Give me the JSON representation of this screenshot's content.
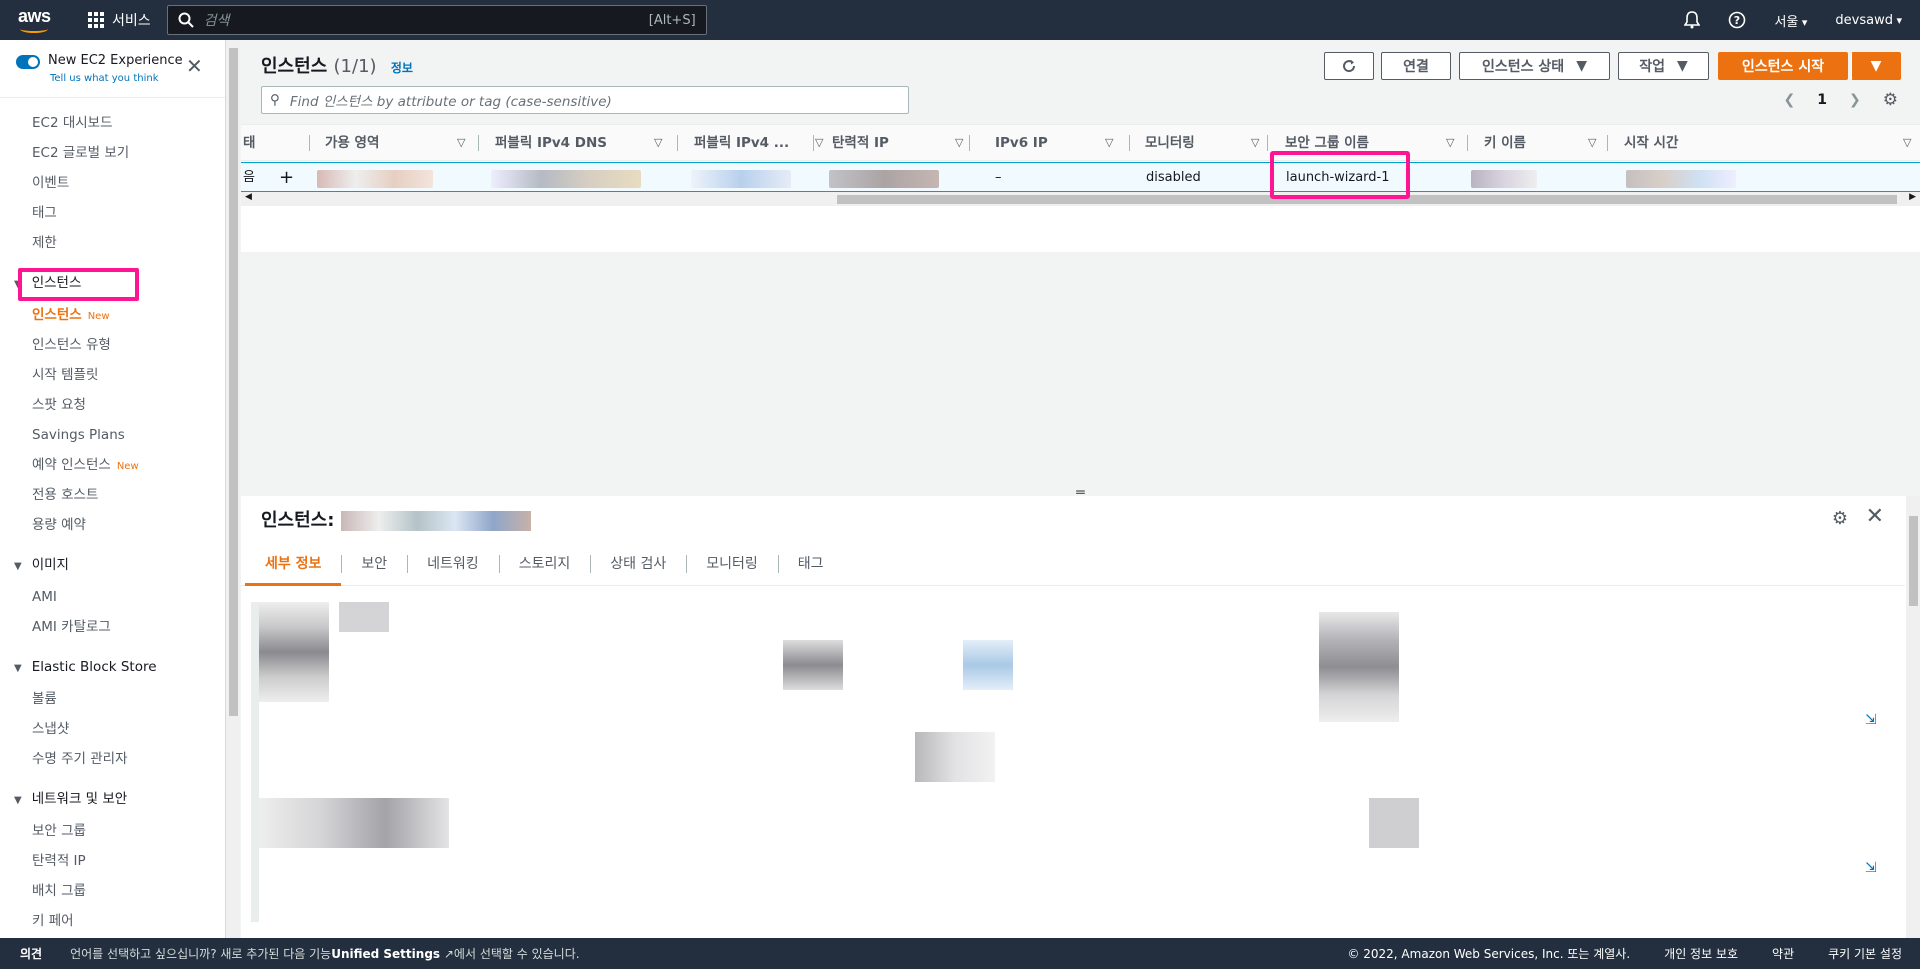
{
  "topnav": {
    "logo": "aws",
    "services_label": "서비스",
    "search_placeholder": "검색",
    "search_shortcut": "[Alt+S]",
    "region": "서울",
    "account": "devsawd"
  },
  "sidebar": {
    "new_experience_title": "New EC2 Experience",
    "new_experience_sub": "Tell us what you think",
    "top_items": [
      "EC2 대시보드",
      "EC2 글로벌 보기",
      "이벤트",
      "태그",
      "제한"
    ],
    "sections": [
      {
        "title": "인스턴스",
        "items": [
          {
            "label": "인스턴스",
            "badge": "New",
            "active": true
          },
          {
            "label": "인스턴스 유형"
          },
          {
            "label": "시작 템플릿"
          },
          {
            "label": "스팟 요청"
          },
          {
            "label": "Savings Plans"
          },
          {
            "label": "예약 인스턴스",
            "badge": "New"
          },
          {
            "label": "전용 호스트"
          },
          {
            "label": "용량 예약"
          }
        ]
      },
      {
        "title": "이미지",
        "items": [
          {
            "label": "AMI"
          },
          {
            "label": "AMI 카탈로그"
          }
        ]
      },
      {
        "title": "Elastic Block Store",
        "items": [
          {
            "label": "볼륨"
          },
          {
            "label": "스냅샷"
          },
          {
            "label": "수명 주기 관리자"
          }
        ]
      },
      {
        "title": "네트워크 및 보안",
        "items": [
          {
            "label": "보안 그룹"
          },
          {
            "label": "탄력적 IP"
          },
          {
            "label": "배치 그룹"
          },
          {
            "label": "키 페어"
          }
        ]
      }
    ]
  },
  "instances": {
    "title": "인스턴스",
    "count": "(1/1)",
    "info": "정보",
    "connect": "연결",
    "state": "인스턴스 상태",
    "actions": "작업",
    "launch": "인스턴스 시작",
    "filter_placeholder": "Find 인스턴스 by attribute or tag (case-sensitive)",
    "page": "1",
    "columns": [
      "태",
      "가용 영역",
      "퍼블릭 IPv4 DNS",
      "퍼블릭 IPv4 ...",
      "탄력적 IP",
      "IPv6 IP",
      "모니터링",
      "보안 그룹 이름",
      "키 이름",
      "시작 시간"
    ],
    "row": {
      "state_trunc": "음",
      "ipv6": "–",
      "monitoring": "disabled",
      "security_group": "launch-wizard-1"
    }
  },
  "detail": {
    "title": "인스턴스:",
    "tabs": [
      "세부 정보",
      "보안",
      "네트워킹",
      "스토리지",
      "상태 검사",
      "모니터링",
      "태그"
    ]
  },
  "footer": {
    "feedback": "의견",
    "message_pre": "언어를 선택하고 싶으십니까? 새로 추가된 다음 기능",
    "message_link": "Unified Settings",
    "message_post": "에서 선택할 수 있습니다.",
    "copyright": "© 2022, Amazon Web Services, Inc. 또는 계열사.",
    "privacy": "개인 정보 보호",
    "terms": "약관",
    "cookies": "쿠키 기본 설정"
  }
}
